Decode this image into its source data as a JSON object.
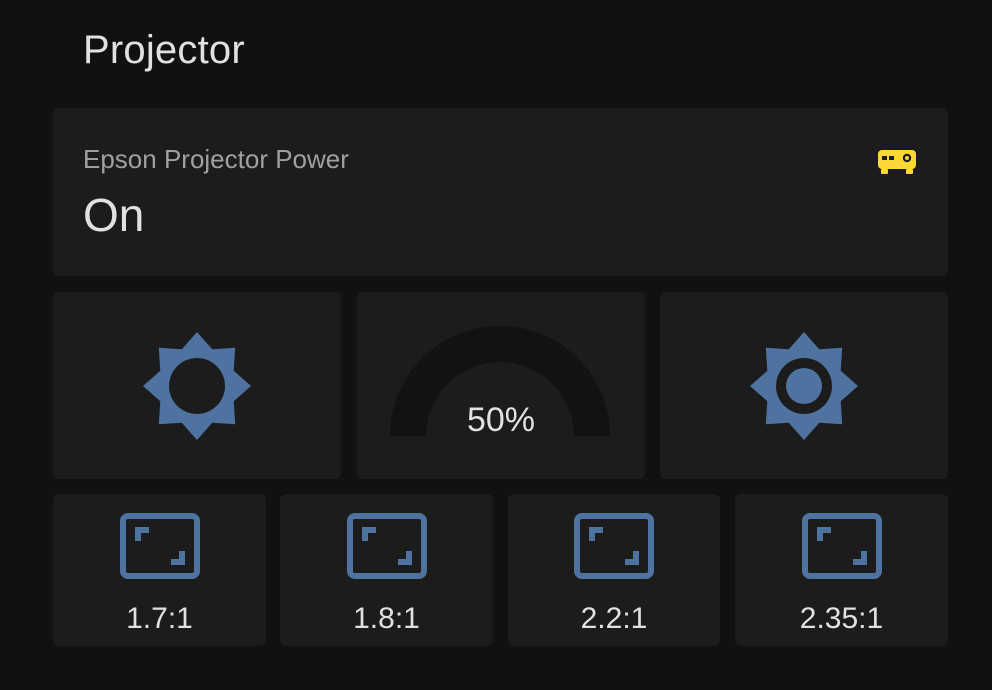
{
  "header": {
    "title": "Projector"
  },
  "power_card": {
    "name": "Epson Projector Power",
    "state": "On",
    "icon": "projector-icon",
    "icon_color": "#fdd835"
  },
  "brightness": {
    "decrease_icon": "brightness-low-icon",
    "increase_icon": "brightness-high-icon",
    "gauge": {
      "value": 50,
      "display": "50%"
    },
    "icon_color": "#4e73a0"
  },
  "aspect_ratios": [
    {
      "label": "1.7:1",
      "icon": "aspect-ratio-icon"
    },
    {
      "label": "1.8:1",
      "icon": "aspect-ratio-icon"
    },
    {
      "label": "2.2:1",
      "icon": "aspect-ratio-icon"
    },
    {
      "label": "2.35:1",
      "icon": "aspect-ratio-icon"
    }
  ],
  "colors": {
    "background": "#111111",
    "card": "#1c1c1c",
    "gauge_track": "#121212",
    "accent_blue": "#4e73a0",
    "accent_yellow": "#fdd835"
  }
}
